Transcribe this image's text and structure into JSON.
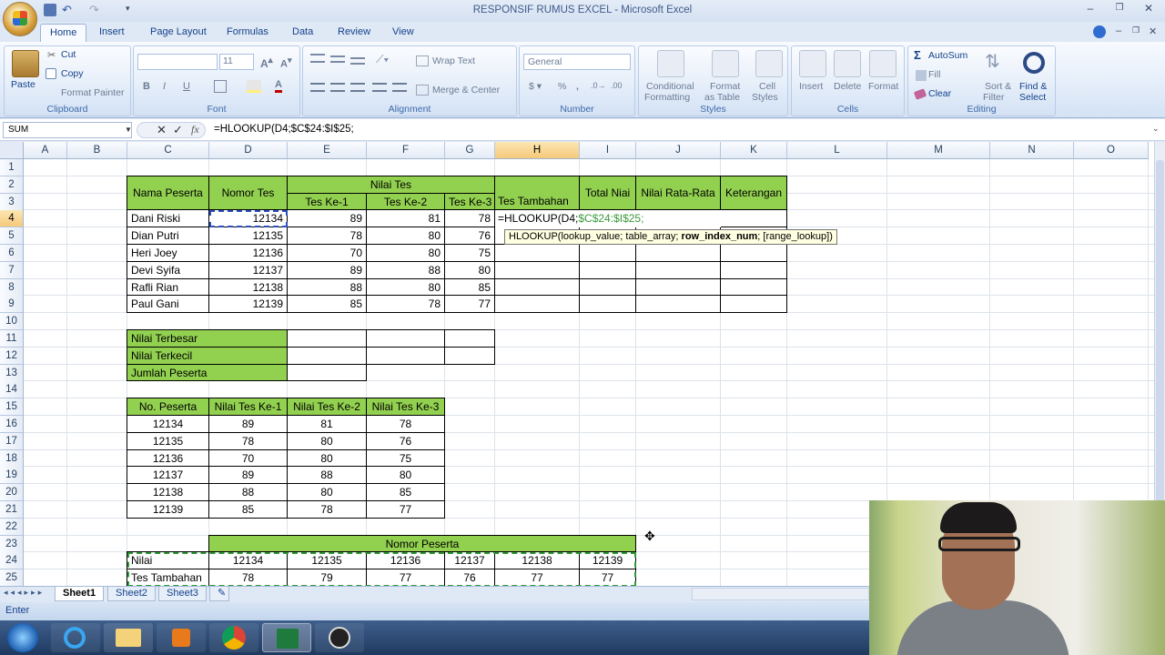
{
  "window": {
    "title": "RESPONSIF RUMUS EXCEL - Microsoft Excel"
  },
  "tabs": [
    "Home",
    "Insert",
    "Page Layout",
    "Formulas",
    "Data",
    "Review",
    "View"
  ],
  "ribbon": {
    "clipboard": {
      "label": "Clipboard",
      "paste": "Paste",
      "cut": "Cut",
      "copy": "Copy",
      "format_painter": "Format Painter"
    },
    "font": {
      "label": "Font",
      "size": "11"
    },
    "alignment": {
      "label": "Alignment",
      "wrap_text": "Wrap Text",
      "merge_center": "Merge & Center"
    },
    "number": {
      "label": "Number",
      "format": "General"
    },
    "styles": {
      "label": "Styles",
      "conditional": "Conditional",
      "conditional2": "Formatting",
      "format_as": "Format",
      "format_as2": "as Table",
      "cell": "Cell",
      "cell2": "Styles"
    },
    "cells": {
      "label": "Cells",
      "insert": "Insert",
      "delete": "Delete",
      "format": "Format"
    },
    "editing": {
      "label": "Editing",
      "autosum": "AutoSum",
      "fill": "Fill",
      "clear": "Clear",
      "sort": "Sort &",
      "sort2": "Filter",
      "find": "Find &",
      "find2": "Select"
    }
  },
  "formula_bar": {
    "name_box": "SUM",
    "formula": "=HLOOKUP(D4;$C$24:$I$25;",
    "fx": "fx"
  },
  "columns": [
    "A",
    "B",
    "C",
    "D",
    "E",
    "F",
    "G",
    "H",
    "I",
    "J",
    "K",
    "L",
    "M",
    "N",
    "O"
  ],
  "rows": [
    "1",
    "2",
    "3",
    "4",
    "5",
    "6",
    "7",
    "8",
    "9",
    "10",
    "11",
    "12",
    "13",
    "14",
    "15",
    "16",
    "17",
    "18",
    "19",
    "20",
    "21",
    "22",
    "23",
    "24",
    "25"
  ],
  "table1": {
    "h_nama": "Nama Peserta",
    "h_nomor": "Nomor Tes",
    "h_nilai": "Nilai Tes",
    "h_tes1": "Tes Ke-1",
    "h_tes2": "Tes Ke-2",
    "h_tes3": "Tes Ke-3",
    "h_tambahan": "Tes Tambahan",
    "h_total": "Total Niai",
    "h_rata": "Nilai Rata-Rata",
    "h_ket": "Keterangan",
    "rows": [
      [
        "Dani Riski",
        "12134",
        "89",
        "81",
        "78"
      ],
      [
        "Dian Putri",
        "12135",
        "78",
        "80",
        "76"
      ],
      [
        "Heri Joey",
        "12136",
        "70",
        "80",
        "75"
      ],
      [
        "Devi Syifa",
        "12137",
        "89",
        "88",
        "80"
      ],
      [
        "Rafli Rian",
        "12138",
        "88",
        "80",
        "85"
      ],
      [
        "Paul Gani",
        "12139",
        "85",
        "78",
        "77"
      ]
    ],
    "editing_formula_a": "=HLOOKUP(D4;",
    "editing_formula_b": "$C$24:$I$25;"
  },
  "summary": {
    "max": "Nilai Terbesar",
    "min": "Nilai Terkecil",
    "count": "Jumlah Peserta"
  },
  "table2": {
    "headers": [
      "No. Peserta",
      "Nilai Tes Ke-1",
      "Nilai Tes Ke-2",
      "Nilai Tes Ke-3"
    ],
    "rows": [
      [
        "12134",
        "89",
        "81",
        "78"
      ],
      [
        "12135",
        "78",
        "80",
        "76"
      ],
      [
        "12136",
        "70",
        "80",
        "75"
      ],
      [
        "12137",
        "89",
        "88",
        "80"
      ],
      [
        "12138",
        "88",
        "80",
        "85"
      ],
      [
        "12139",
        "85",
        "78",
        "77"
      ]
    ]
  },
  "table3": {
    "title": "Nomor Peserta",
    "row1_label": "Nilai",
    "row1": [
      "12134",
      "12135",
      "12136",
      "12137",
      "12138",
      "12139"
    ],
    "row2_label": "Tes Tambahan",
    "row2": [
      "78",
      "79",
      "77",
      "76",
      "77",
      "77"
    ]
  },
  "tooltip": {
    "a": "HLOOKUP(lookup_value; table_array; ",
    "b": "row_index_num",
    "c": "; [range_lookup])"
  },
  "sheets": [
    "Sheet1",
    "Sheet2",
    "Sheet3"
  ],
  "status": {
    "mode": "Enter"
  },
  "colors": {
    "header_green": "#92d050",
    "ribbon_blue": "#dfe8f5",
    "select_orange": "#f6c97a"
  }
}
